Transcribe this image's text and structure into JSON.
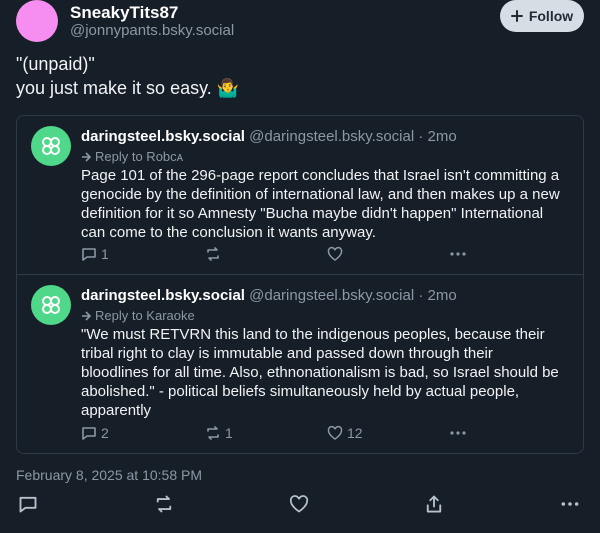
{
  "author": {
    "display_name": "SneakyTits87",
    "handle": "@jonnypants.bsky.social",
    "follow_label": "Follow"
  },
  "post": {
    "line1": "\"(unpaid)\"",
    "line2": "you just make it so easy. 🤷‍♂️"
  },
  "quoted": [
    {
      "name": "daringsteel.bsky.social",
      "meta": "@daringsteel.bsky.social · 2mo",
      "reply_to": "Reply to Robcᴀ",
      "lines": [
        "Page 101 of the 296-page report concludes that Israel isn't committing a",
        "genocide by the definition of international law, and then makes up a new",
        "definition for it so Amnesty \"Bucha maybe didn't happen\" International",
        "can come to the conclusion it wants anyway."
      ],
      "replies": "1",
      "reposts": "",
      "likes": ""
    },
    {
      "name": "daringsteel.bsky.social",
      "meta": "@daringsteel.bsky.social · 2mo",
      "reply_to": "Reply to Karaoke",
      "lines": [
        "\"We must RETVRN this land to the indigenous peoples, because their",
        "tribal right to clay is immutable and passed down through their",
        "bloodlines for all time. Also, ethnonationalism is bad, so Israel should be",
        "abolished.\" - political beliefs simultaneously held by actual people,",
        "apparently"
      ],
      "replies": "2",
      "reposts": "1",
      "likes": "12"
    }
  ],
  "timestamp": "February 8, 2025 at 10:58 PM",
  "colors": {
    "background": "#161e27",
    "avatar_author": "#f58ef0",
    "avatar_quoted": "#4fd88a",
    "muted": "#8b98a5"
  }
}
